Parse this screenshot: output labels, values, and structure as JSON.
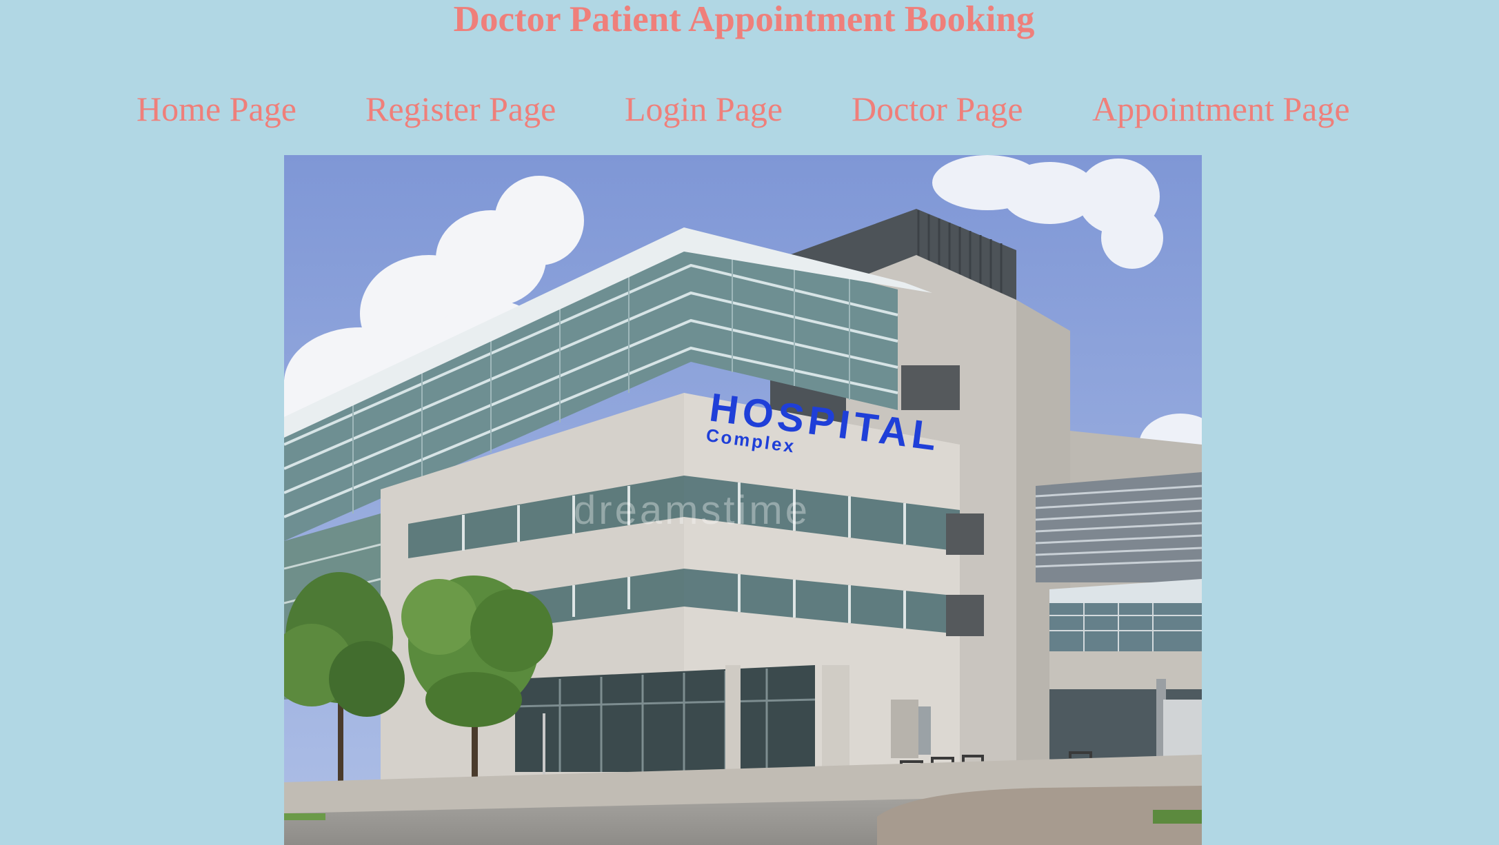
{
  "header": {
    "title": "Doctor Patient Appointment Booking"
  },
  "nav": {
    "items": [
      {
        "label": "Home Page"
      },
      {
        "label": "Register Page"
      },
      {
        "label": "Login Page"
      },
      {
        "label": "Doctor Page"
      },
      {
        "label": "Appointment Page"
      }
    ]
  },
  "hero": {
    "sign_main": "HOSPITAL",
    "sign_sub": "Complex",
    "watermark": "dreamstime"
  },
  "colors": {
    "background": "#b1d7e4",
    "accent_text": "#ef7f7a",
    "sign_blue": "#1f3fd8"
  }
}
